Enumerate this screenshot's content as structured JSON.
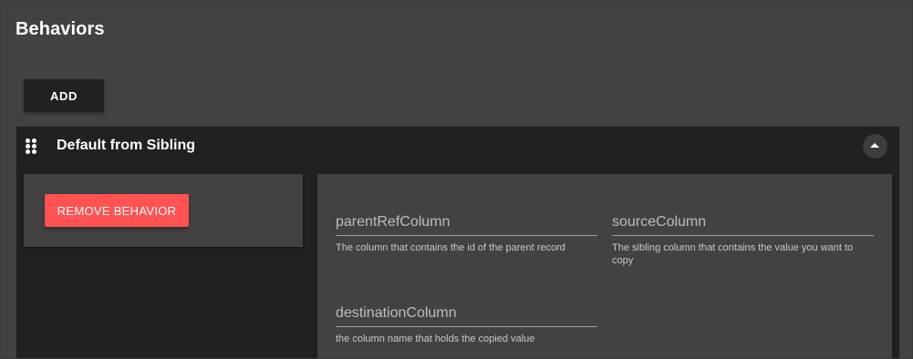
{
  "page": {
    "title": "Behaviors",
    "add_button_label": "ADD"
  },
  "behavior_panel": {
    "title": "Default from Sibling",
    "drag_icon": "drag-handle-icon",
    "collapse_icon": "chevron-up-icon",
    "remove_button_label": "REMOVE BEHAVIOR",
    "fields": [
      {
        "placeholder": "parentRefColumn",
        "value": "",
        "hint": "The column that contains the id of the parent record"
      },
      {
        "placeholder": "sourceColumn",
        "value": "",
        "hint": "The sibling column that contains the value you want to copy"
      },
      {
        "placeholder": "destinationColumn",
        "value": "",
        "hint": "the column name that holds the copied value"
      }
    ]
  },
  "colors": {
    "background": "#424242",
    "panel": "#212121",
    "danger": "#ff5252"
  }
}
